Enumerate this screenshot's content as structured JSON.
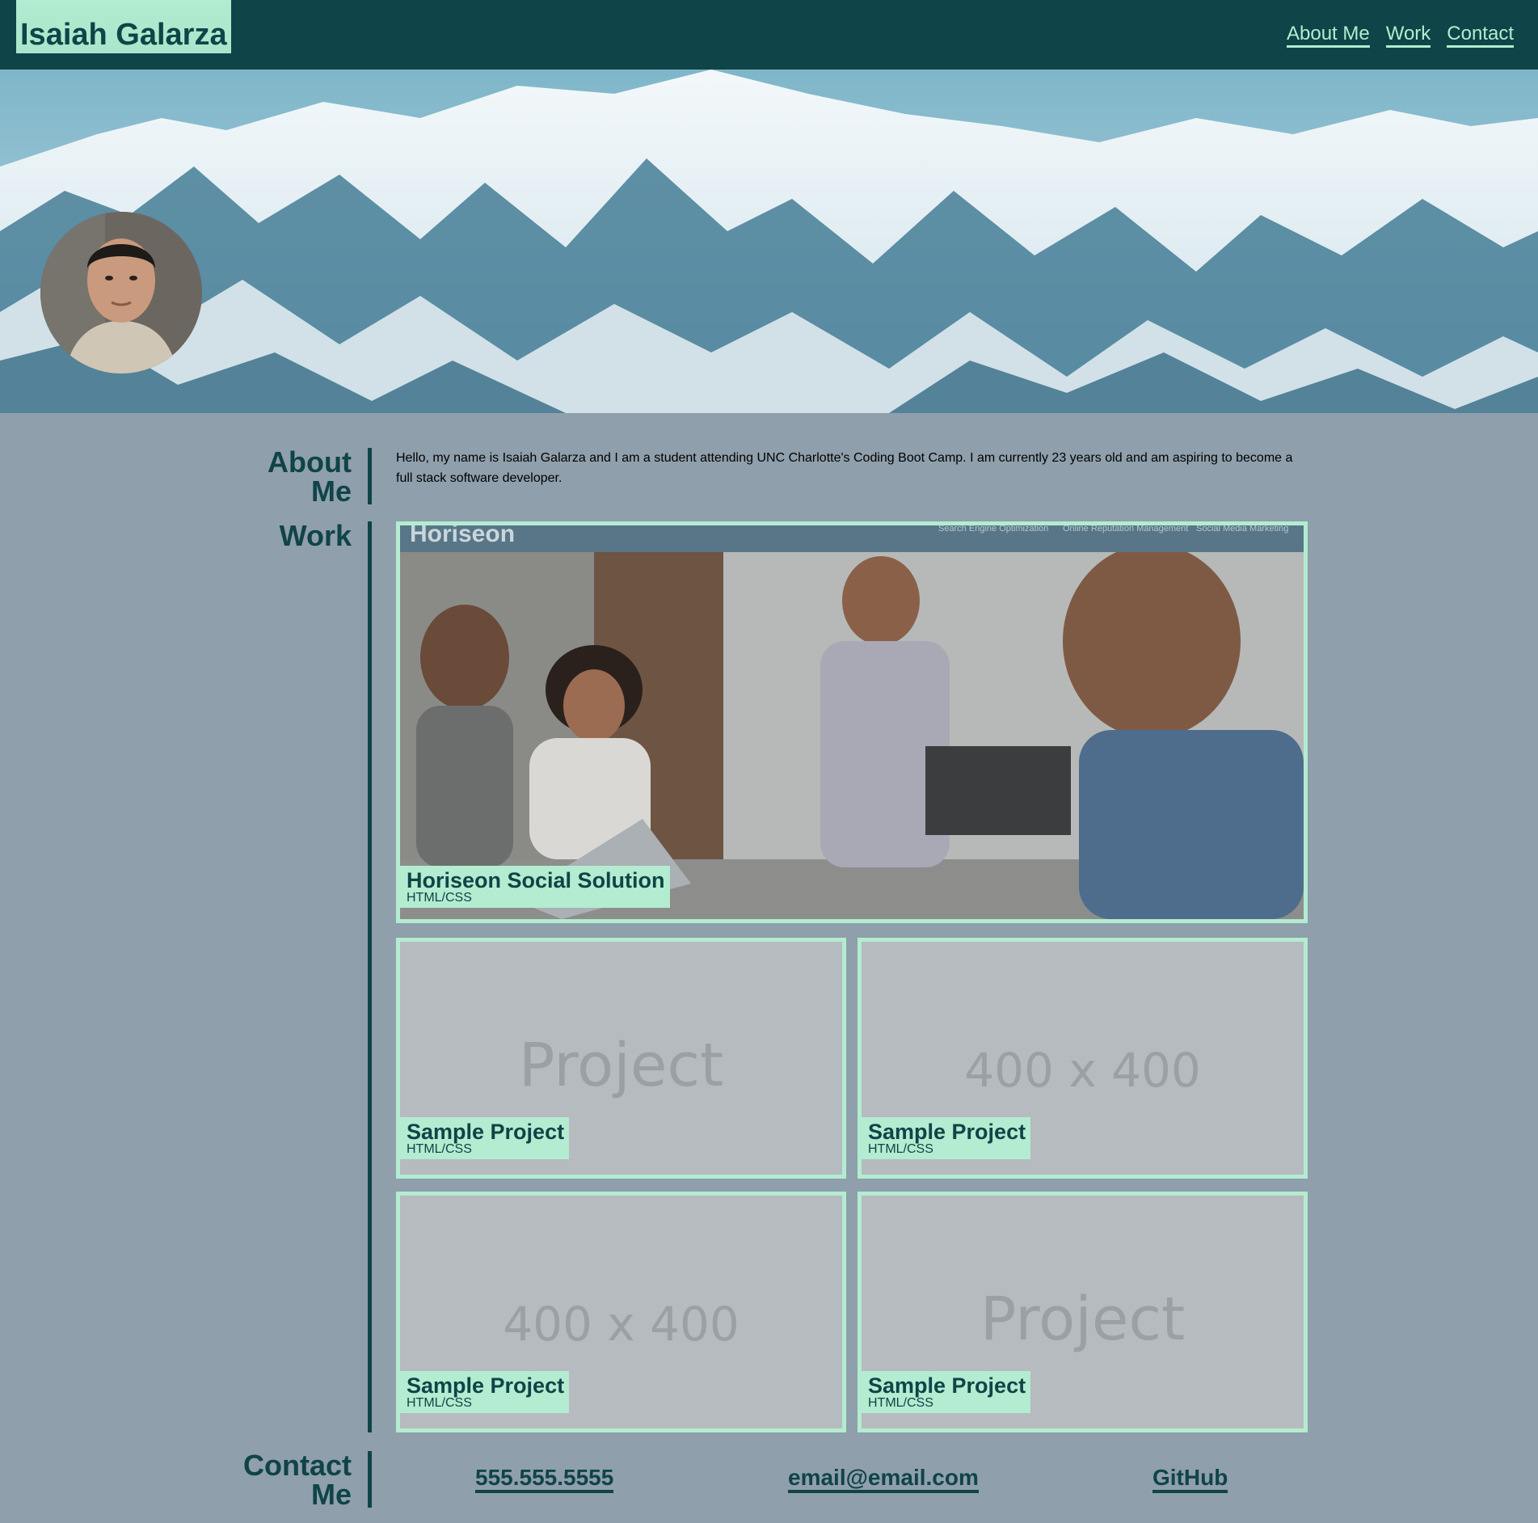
{
  "header": {
    "title": "Isaiah Galarza",
    "nav": [
      "About Me",
      "Work",
      "Contact"
    ]
  },
  "about": {
    "heading": "About Me",
    "text": "Hello, my name is Isaiah Galarza and I am a student attending UNC Charlotte's Coding Boot Camp. I am currently 23 years old and am aspiring to become a full stack software developer."
  },
  "work": {
    "heading": "Work",
    "featured": {
      "name": "Horiseon Social Solution",
      "tech": "HTML/CSS",
      "screenshot_logo": "Horiseon",
      "screenshot_nav": [
        "Search Engine Optimization",
        "Online Reputation Management",
        "Social Media Marketing"
      ]
    },
    "projects": [
      {
        "name": "Sample Project",
        "tech": "HTML/CSS",
        "placeholder": "Project"
      },
      {
        "name": "Sample Project",
        "tech": "HTML/CSS",
        "placeholder": "400 x 400"
      },
      {
        "name": "Sample Project",
        "tech": "HTML/CSS",
        "placeholder": "400 x 400"
      },
      {
        "name": "Sample Project",
        "tech": "HTML/CSS",
        "placeholder": "Project"
      }
    ]
  },
  "contact": {
    "heading": "Contact Me",
    "phone": "555.555.5555",
    "email": "email@email.com",
    "github": "GitHub"
  },
  "colors": {
    "header_bg": "#0f4448",
    "accent": "#b3ecd0",
    "page_bg": "#8f9fab"
  }
}
